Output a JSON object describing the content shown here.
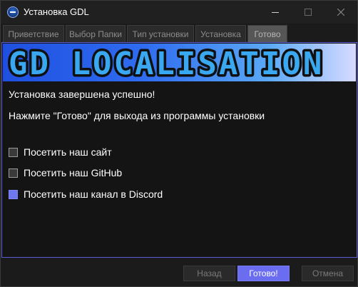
{
  "window": {
    "title": "Установка GDL"
  },
  "tabs": [
    {
      "label": "Приветствие"
    },
    {
      "label": "Выбор Папки"
    },
    {
      "label": "Тип установки"
    },
    {
      "label": "Установка"
    },
    {
      "label": "Готово"
    }
  ],
  "banner": {
    "text": "GD LOCALISATION"
  },
  "main": {
    "success_message": "Установка завершена успешно!",
    "instruction": "Нажмите \"Готово\" для выхода из программы установки"
  },
  "options": [
    {
      "label": "Посетить наш сайт",
      "checked": false
    },
    {
      "label": "Посетить наш GitHub",
      "checked": false
    },
    {
      "label": "Посетить наш канал в Discord",
      "checked": true
    }
  ],
  "buttons": {
    "back": "Назад",
    "done": "Готово!",
    "cancel": "Отмена"
  },
  "colors": {
    "accent": "#6b6df0",
    "background": "#141414"
  }
}
